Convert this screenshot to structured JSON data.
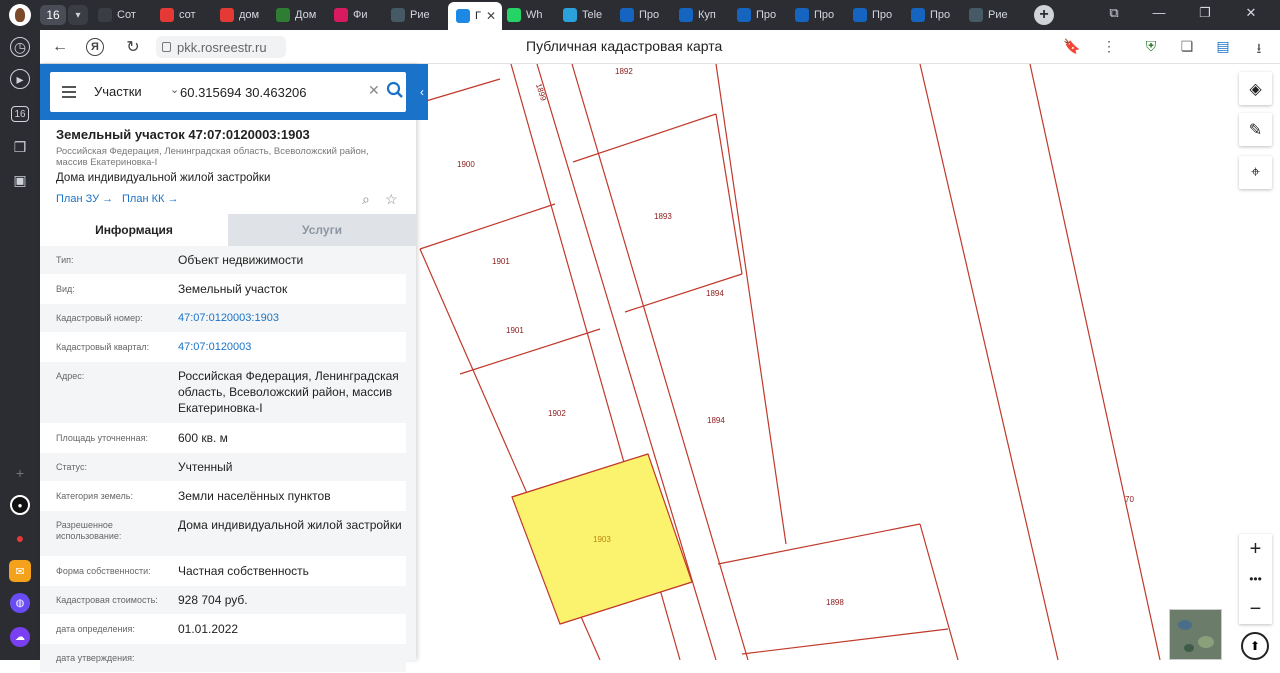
{
  "browser": {
    "tab_count": "16",
    "tabs": [
      {
        "label": "Сот",
        "icon": "yo",
        "color": "#3a3d44"
      },
      {
        "label": "сот",
        "icon": "yandex",
        "color": "#e53935"
      },
      {
        "label": "дом",
        "icon": "yandex",
        "color": "#e53935"
      },
      {
        "label": "Дом",
        "icon": "avito",
        "color": "#2e7d32"
      },
      {
        "label": "Фи",
        "icon": "play",
        "color": "#d81b60"
      },
      {
        "label": "Рие",
        "icon": "grid",
        "color": "#455a64"
      },
      {
        "label": "Г",
        "icon": "rosreestr",
        "color": "#1e88e5"
      },
      {
        "label": "Wh",
        "icon": "whatsapp",
        "color": "#25d366"
      },
      {
        "label": "Tele",
        "icon": "telegram",
        "color": "#2aa1da"
      },
      {
        "label": "Про",
        "icon": "wave",
        "color": "#1565c0"
      },
      {
        "label": "Куп",
        "icon": "wave",
        "color": "#1565c0"
      },
      {
        "label": "Про",
        "icon": "wave",
        "color": "#1565c0"
      },
      {
        "label": "Про",
        "icon": "wave",
        "color": "#1565c0"
      },
      {
        "label": "Про",
        "icon": "wave",
        "color": "#1565c0"
      },
      {
        "label": "Про",
        "icon": "wave",
        "color": "#1565c0"
      },
      {
        "label": "Рие",
        "icon": "grid",
        "color": "#455a64"
      }
    ],
    "url": "pkk.rosreestr.ru",
    "page_title": "Публичная кадастровая карта"
  },
  "search": {
    "type": "Участки",
    "value": "60.315694 30.463206"
  },
  "object": {
    "title": "Земельный участок 47:07:0120003:1903",
    "address_short": "Российская Федерация, Ленинградская область, Всеволожский район, массив Екатериновка-I",
    "purpose": "Дома индивидуальной жилой застройки",
    "link_plan_zu": "План ЗУ",
    "link_plan_kk": "План КК"
  },
  "panel_tabs": {
    "info": "Информация",
    "services": "Услуги"
  },
  "info_rows": [
    {
      "key": "Тип:",
      "value": "Объект недвижимости"
    },
    {
      "key": "Вид:",
      "value": "Земельный участок"
    },
    {
      "key": "Кадастровый номер:",
      "value": "47:07:0120003:1903"
    },
    {
      "key": "Кадастровый квартал:",
      "value": "47:07:0120003"
    },
    {
      "key": "Адрес:",
      "value": "Российская Федерация, Ленинградская область, Всеволожский район, массив Екатериновка-I"
    },
    {
      "key": "Площадь уточненная:",
      "value": "600 кв. м"
    },
    {
      "key": "Статус:",
      "value": "Учтенный"
    },
    {
      "key": "Категория земель:",
      "value": "Земли населённых пунктов"
    },
    {
      "key": "Разрешенное использование:",
      "value": "Дома индивидуальной жилой застройки"
    },
    {
      "key": "Форма собственности:",
      "value": "Частная собственность"
    },
    {
      "key": "Кадастровая стоимость:",
      "value": "928 704 руб."
    },
    {
      "key": "дата определения:",
      "value": "01.01.2022"
    },
    {
      "key": "дата утверждения:",
      "value": ""
    }
  ],
  "map": {
    "parcel_labels": [
      "1892",
      "1899",
      "1900",
      "1893",
      "1901",
      "1894",
      "1901",
      "1902",
      "1894",
      "1903",
      "1898",
      "70"
    ],
    "highlight_color": "#fbf36e",
    "boundary_color": "#c0392b"
  }
}
